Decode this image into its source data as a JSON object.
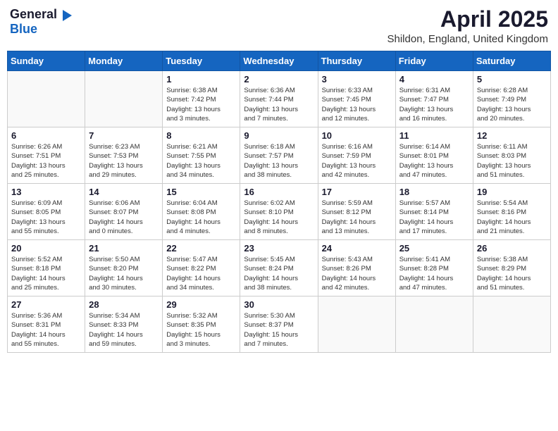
{
  "logo": {
    "general": "General",
    "blue": "Blue"
  },
  "header": {
    "month": "April 2025",
    "location": "Shildon, England, United Kingdom"
  },
  "weekdays": [
    "Sunday",
    "Monday",
    "Tuesday",
    "Wednesday",
    "Thursday",
    "Friday",
    "Saturday"
  ],
  "weeks": [
    [
      {
        "day": "",
        "info": ""
      },
      {
        "day": "",
        "info": ""
      },
      {
        "day": "1",
        "info": "Sunrise: 6:38 AM\nSunset: 7:42 PM\nDaylight: 13 hours\nand 3 minutes."
      },
      {
        "day": "2",
        "info": "Sunrise: 6:36 AM\nSunset: 7:44 PM\nDaylight: 13 hours\nand 7 minutes."
      },
      {
        "day": "3",
        "info": "Sunrise: 6:33 AM\nSunset: 7:45 PM\nDaylight: 13 hours\nand 12 minutes."
      },
      {
        "day": "4",
        "info": "Sunrise: 6:31 AM\nSunset: 7:47 PM\nDaylight: 13 hours\nand 16 minutes."
      },
      {
        "day": "5",
        "info": "Sunrise: 6:28 AM\nSunset: 7:49 PM\nDaylight: 13 hours\nand 20 minutes."
      }
    ],
    [
      {
        "day": "6",
        "info": "Sunrise: 6:26 AM\nSunset: 7:51 PM\nDaylight: 13 hours\nand 25 minutes."
      },
      {
        "day": "7",
        "info": "Sunrise: 6:23 AM\nSunset: 7:53 PM\nDaylight: 13 hours\nand 29 minutes."
      },
      {
        "day": "8",
        "info": "Sunrise: 6:21 AM\nSunset: 7:55 PM\nDaylight: 13 hours\nand 34 minutes."
      },
      {
        "day": "9",
        "info": "Sunrise: 6:18 AM\nSunset: 7:57 PM\nDaylight: 13 hours\nand 38 minutes."
      },
      {
        "day": "10",
        "info": "Sunrise: 6:16 AM\nSunset: 7:59 PM\nDaylight: 13 hours\nand 42 minutes."
      },
      {
        "day": "11",
        "info": "Sunrise: 6:14 AM\nSunset: 8:01 PM\nDaylight: 13 hours\nand 47 minutes."
      },
      {
        "day": "12",
        "info": "Sunrise: 6:11 AM\nSunset: 8:03 PM\nDaylight: 13 hours\nand 51 minutes."
      }
    ],
    [
      {
        "day": "13",
        "info": "Sunrise: 6:09 AM\nSunset: 8:05 PM\nDaylight: 13 hours\nand 55 minutes."
      },
      {
        "day": "14",
        "info": "Sunrise: 6:06 AM\nSunset: 8:07 PM\nDaylight: 14 hours\nand 0 minutes."
      },
      {
        "day": "15",
        "info": "Sunrise: 6:04 AM\nSunset: 8:08 PM\nDaylight: 14 hours\nand 4 minutes."
      },
      {
        "day": "16",
        "info": "Sunrise: 6:02 AM\nSunset: 8:10 PM\nDaylight: 14 hours\nand 8 minutes."
      },
      {
        "day": "17",
        "info": "Sunrise: 5:59 AM\nSunset: 8:12 PM\nDaylight: 14 hours\nand 13 minutes."
      },
      {
        "day": "18",
        "info": "Sunrise: 5:57 AM\nSunset: 8:14 PM\nDaylight: 14 hours\nand 17 minutes."
      },
      {
        "day": "19",
        "info": "Sunrise: 5:54 AM\nSunset: 8:16 PM\nDaylight: 14 hours\nand 21 minutes."
      }
    ],
    [
      {
        "day": "20",
        "info": "Sunrise: 5:52 AM\nSunset: 8:18 PM\nDaylight: 14 hours\nand 25 minutes."
      },
      {
        "day": "21",
        "info": "Sunrise: 5:50 AM\nSunset: 8:20 PM\nDaylight: 14 hours\nand 30 minutes."
      },
      {
        "day": "22",
        "info": "Sunrise: 5:47 AM\nSunset: 8:22 PM\nDaylight: 14 hours\nand 34 minutes."
      },
      {
        "day": "23",
        "info": "Sunrise: 5:45 AM\nSunset: 8:24 PM\nDaylight: 14 hours\nand 38 minutes."
      },
      {
        "day": "24",
        "info": "Sunrise: 5:43 AM\nSunset: 8:26 PM\nDaylight: 14 hours\nand 42 minutes."
      },
      {
        "day": "25",
        "info": "Sunrise: 5:41 AM\nSunset: 8:28 PM\nDaylight: 14 hours\nand 47 minutes."
      },
      {
        "day": "26",
        "info": "Sunrise: 5:38 AM\nSunset: 8:29 PM\nDaylight: 14 hours\nand 51 minutes."
      }
    ],
    [
      {
        "day": "27",
        "info": "Sunrise: 5:36 AM\nSunset: 8:31 PM\nDaylight: 14 hours\nand 55 minutes."
      },
      {
        "day": "28",
        "info": "Sunrise: 5:34 AM\nSunset: 8:33 PM\nDaylight: 14 hours\nand 59 minutes."
      },
      {
        "day": "29",
        "info": "Sunrise: 5:32 AM\nSunset: 8:35 PM\nDaylight: 15 hours\nand 3 minutes."
      },
      {
        "day": "30",
        "info": "Sunrise: 5:30 AM\nSunset: 8:37 PM\nDaylight: 15 hours\nand 7 minutes."
      },
      {
        "day": "",
        "info": ""
      },
      {
        "day": "",
        "info": ""
      },
      {
        "day": "",
        "info": ""
      }
    ]
  ]
}
